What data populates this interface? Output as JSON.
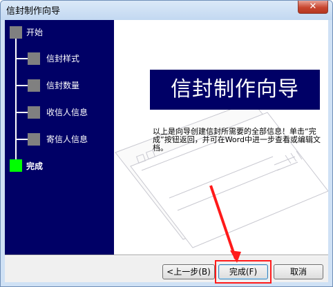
{
  "window": {
    "title": "信封制作向导",
    "close_label": "✕"
  },
  "steps": [
    {
      "label": "开始",
      "active": false
    },
    {
      "label": "信封样式",
      "active": false
    },
    {
      "label": "信封数量",
      "active": false
    },
    {
      "label": "收信人信息",
      "active": false
    },
    {
      "label": "寄信人信息",
      "active": false
    },
    {
      "label": "完成",
      "active": true
    }
  ],
  "content": {
    "banner_title": "信封制作向导",
    "description": "以上是向导创建信封所需要的全部信息！单击“完成”按钮返回，并可在Word中进一步查看或编辑文档。"
  },
  "buttons": {
    "back": "<上一步(B)",
    "finish": "完成(F)",
    "cancel": "取消"
  },
  "colors": {
    "sidebar": "#000066",
    "active_step": "#00ff00",
    "inactive_step": "#808080",
    "annotation": "#ff1a1a"
  }
}
